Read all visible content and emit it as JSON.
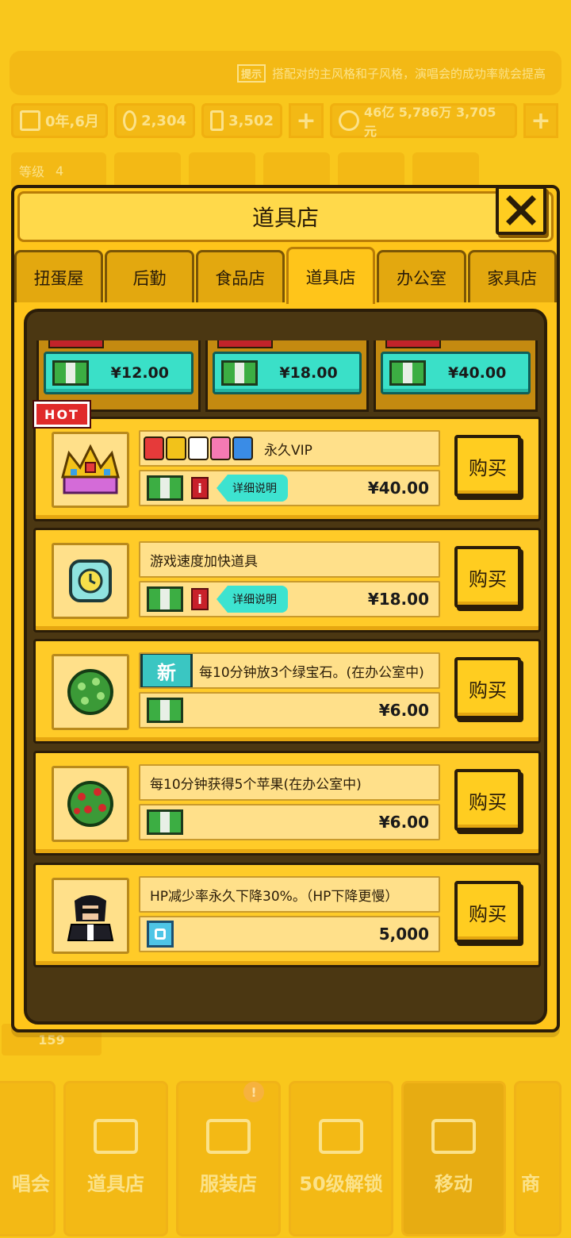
{
  "background": {
    "tip_badge": "提示",
    "tip_text": "搭配对的主风格和子风格，演唱会的成功率就会提高",
    "date": "0年,6月",
    "coins": "2,304",
    "tickets": "3,502",
    "money": "46亿 5,786万 3,705元",
    "level_label": "等级",
    "level_value": "4",
    "count": "159",
    "nav": [
      "唱会",
      "道具店",
      "服装店",
      "50级解锁",
      "移动",
      "商"
    ]
  },
  "modal": {
    "title": "道具店",
    "tabs": [
      "扭蛋屋",
      "后勤",
      "食品店",
      "道具店",
      "办公室",
      "家具店"
    ],
    "active_tab": 3
  },
  "prev_prices": [
    "¥12.00",
    "¥18.00",
    "¥40.00"
  ],
  "items": [
    {
      "name": "永久VIP",
      "price": "¥40.00",
      "detail": "详细说明",
      "buy": "购买",
      "hot": "HOT"
    },
    {
      "name": "游戏速度加快道具",
      "price": "¥18.00",
      "detail": "详细说明",
      "buy": "购买"
    },
    {
      "name": "每10分钟放3个绿宝石。(在办公室中)",
      "price": "¥6.00",
      "buy": "购买",
      "new": "新"
    },
    {
      "name": "每10分钟获得5个苹果(在办公室中)",
      "price": "¥6.00",
      "buy": "购买"
    },
    {
      "name": "HP减少率永久下降30%。（HP下降更慢）",
      "price": "5,000",
      "buy": "购买"
    }
  ],
  "colors": {
    "accent": "#ffc51a",
    "frame": "#4b3712",
    "teal": "#3de3d0",
    "outline": "#2b1d08"
  }
}
